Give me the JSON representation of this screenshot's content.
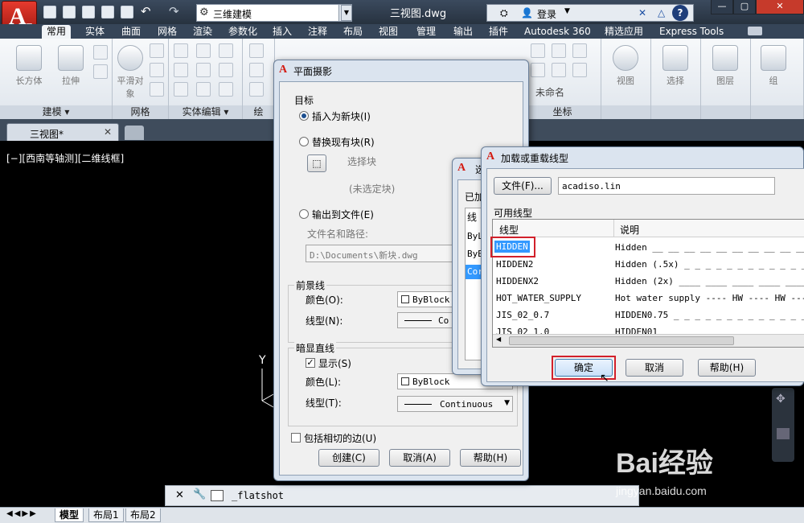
{
  "app": {
    "workspace": "三维建模",
    "window_title": "三视图.dwg",
    "login_label": "登录"
  },
  "ribbon_tabs": [
    "常用",
    "实体",
    "曲面",
    "网格",
    "渲染",
    "参数化",
    "插入",
    "注释",
    "布局",
    "视图",
    "管理",
    "输出",
    "插件",
    "Autodesk 360",
    "精选应用",
    "Express Tools"
  ],
  "ribbon": {
    "box_label": "长方体",
    "extrude_label": "拉伸",
    "smooth_label": "平滑对象",
    "group_modeling": "建模",
    "group_mesh": "网格",
    "group_solid_edit": "实体编辑",
    "group_draw_partial": "绘",
    "unnamed": "未命名",
    "coords": "坐标",
    "view": "视图",
    "select": "选择",
    "layers": "图层",
    "group": "组"
  },
  "doc_tab": {
    "name": "三视图*"
  },
  "viewport_label": "[−][西南等轴测][二维线框]",
  "axis_y": "Y",
  "command_line": {
    "prompt": "_flatshot"
  },
  "layout_tabs": [
    "模型",
    "布局1",
    "布局2"
  ],
  "flatshot_dialog": {
    "title": "平面摄影",
    "target_group": "目标",
    "insert_new_block": "插入为新块(I)",
    "replace_block": "替换现有块(R)",
    "select_block": "选择块",
    "no_block": "(未选定块)",
    "export_file": "输出到文件(E)",
    "file_path_label": "文件名和路径:",
    "file_path": "D:\\Documents\\新块.dwg",
    "foreground_group": "前景线",
    "fg_color_label": "颜色(O):",
    "fg_color": "ByBlock",
    "fg_linetype_label": "线型(N):",
    "fg_linetype": "Co",
    "hidden_group": "暗显直线",
    "show_label": "显示(S)",
    "hid_color_label": "颜色(L):",
    "hid_color": "ByBlock",
    "hid_linetype_label": "线型(T):",
    "hid_linetype": "Continuous",
    "include_tangent": "包括相切的边(U)",
    "create_btn": "创建(C)",
    "cancel_btn": "取消(A)",
    "help_btn": "帮助(H)"
  },
  "select_linetype_dialog": {
    "title_fragment": "选",
    "loaded_fragment": "已加",
    "col_fragment": "线",
    "items": [
      "ByL",
      "ByB",
      "Cor"
    ]
  },
  "load_linetype_dialog": {
    "title": "加载或重载线型",
    "file_btn": "文件(F)...",
    "file_value": "acadiso.lin",
    "available_label": "可用线型",
    "col_linetype": "线型",
    "col_desc": "说明",
    "rows": [
      {
        "name": "HIDDEN",
        "desc": "Hidden __ __ __ __ __ __ __ __ __ __ __"
      },
      {
        "name": "HIDDEN2",
        "desc": "Hidden (.5x) _ _ _ _ _ _ _ _ _ _ _ _ _ _"
      },
      {
        "name": "HIDDENX2",
        "desc": "Hidden (2x) ____ ____ ____ ____ ____ ____"
      },
      {
        "name": "HOT_WATER_SUPPLY",
        "desc": "Hot water supply ---- HW ---- HW ---- H"
      },
      {
        "name": "JIS_02_0.7",
        "desc": "HIDDEN0.75 _ _ _ _ _ _ _ _ _ _ _ _ _ _ _"
      },
      {
        "name": "JIS_02_1.0",
        "desc": "HIDDEN01"
      }
    ],
    "ok_btn": "确定",
    "cancel_btn": "取消",
    "help_btn": "帮助(H)"
  },
  "watermark": {
    "brand": "Bai经验",
    "url": "jingyan.baidu.com"
  }
}
